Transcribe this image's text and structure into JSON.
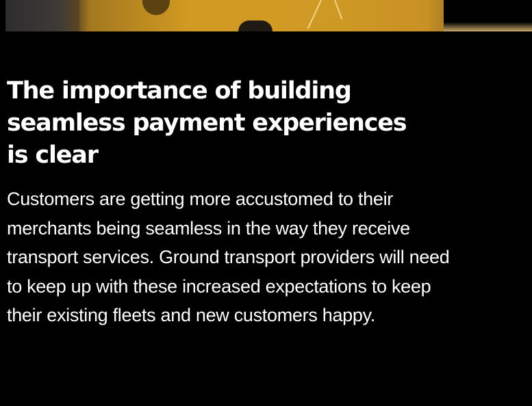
{
  "article": {
    "title": "The importance of building seamless payment experiences is clear",
    "body": "Customers are getting more accustomed to their merchants being seamless in the way they receive transport services. Ground transport providers will need to keep up with these increased expectations to keep their existing fleets and new customers happy."
  },
  "colors": {
    "background": "#000000",
    "text": "#ffffff",
    "image_accent": "#d29a22"
  }
}
